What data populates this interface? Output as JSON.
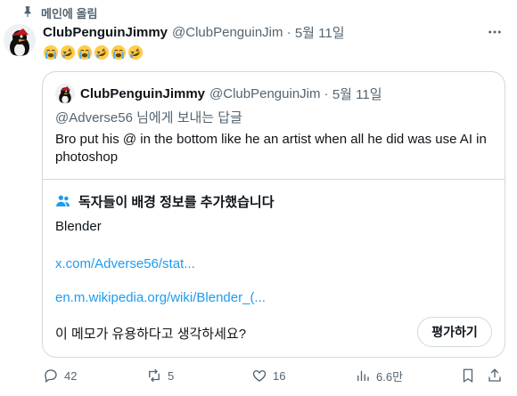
{
  "pinned": {
    "label": "메인에 올림"
  },
  "tweet": {
    "author_name": "ClubPenguinJimmy",
    "handle": "@ClubPenguinJim",
    "separator": " · ",
    "date": "5월 11일",
    "emoji_icons": [
      "loudly-crying-face-icon",
      "rofl-face-icon",
      "loudly-crying-face-icon",
      "rofl-face-icon",
      "loudly-crying-face-icon",
      "rofl-face-icon"
    ]
  },
  "quoted": {
    "author_name": "ClubPenguinJimmy",
    "handle": "@ClubPenguinJim",
    "separator": " · ",
    "date": "5월 11일",
    "reply_handle": "@Adverse56",
    "reply_suffix": " 님에게 보내는 답글",
    "text": "Bro put his @ in the bottom like he an artist when all he did was use AI in photoshop"
  },
  "community_note": {
    "title": "독자들이 배경 정보를 추가했습니다",
    "body": "Blender",
    "link1": "x.com/Adverse56/stat...",
    "link2": "en.m.wikipedia.org/wiki/Blender_(...",
    "question": "이 메모가 유용하다고 생각하세요?",
    "rate_label": "평가하기"
  },
  "actions": {
    "replies": "42",
    "reposts": "5",
    "likes": "16",
    "views": "6.6만"
  },
  "colors": {
    "accent": "#1d9bf0",
    "muted": "#536471",
    "border": "#cfd9de"
  }
}
